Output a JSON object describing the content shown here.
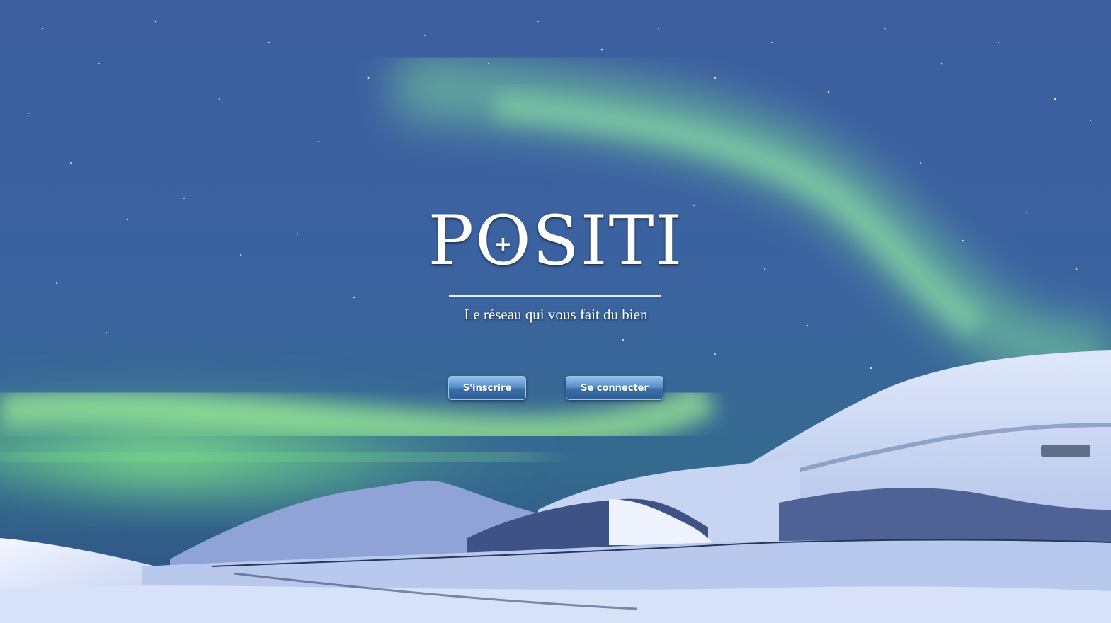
{
  "brand": {
    "logo_text_left": "P",
    "logo_text_o": "O",
    "logo_text_right": "SITI",
    "logo_plus": "+",
    "tagline": "Le réseau qui vous fait du bien"
  },
  "actions": {
    "signup_label": "S'inscrire",
    "login_label": "Se connecter"
  },
  "colors": {
    "button_top": "#8dbfea",
    "button_bottom": "#2f5d93",
    "aurora_green": "#7fe08a",
    "sky_blue": "#3a5ea3"
  }
}
